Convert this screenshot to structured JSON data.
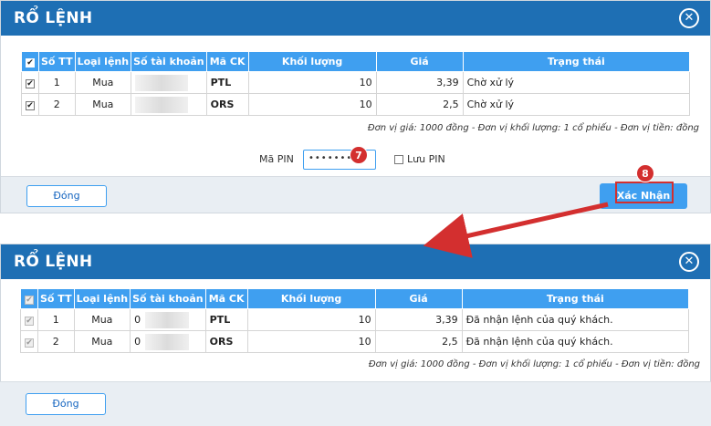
{
  "panels": {
    "before": {
      "title": "RỔ LỆNH",
      "close_icon": "close-circle-icon",
      "columns": [
        "Số TT",
        "Loại lệnh",
        "Số tài khoản",
        "Mã CK",
        "Khối lượng",
        "Giá",
        "Trạng thái"
      ],
      "rows": [
        {
          "check": "✔",
          "stt": "1",
          "type": "Mua",
          "account": "",
          "symbol": "PTL",
          "qty": "10",
          "price": "3,39",
          "status": "Chờ xử lý"
        },
        {
          "check": "✔",
          "stt": "2",
          "type": "Mua",
          "account": "",
          "symbol": "ORS",
          "qty": "10",
          "price": "2,5",
          "status": "Chờ xử lý"
        }
      ],
      "header_check": "✔",
      "unit_note": "Đơn vị giá: 1000 đồng - Đơn vị khối lượng: 1 cổ phiếu - Đơn vị tiền: đồng",
      "pin": {
        "label": "Mã PIN",
        "value": "••••••••",
        "save_label": "Lưu PIN"
      },
      "close_button": "Đóng",
      "confirm_button": "Xác Nhận",
      "step_7": "7",
      "step_8": "8"
    },
    "after": {
      "title": "RỔ LỆNH",
      "close_icon": "close-circle-icon",
      "columns": [
        "Số TT",
        "Loại lệnh",
        "Số tài khoản",
        "Mã CK",
        "Khối lượng",
        "Giá",
        "Trạng thái"
      ],
      "rows": [
        {
          "check": "✔",
          "stt": "1",
          "type": "Mua",
          "account": "0",
          "symbol": "PTL",
          "qty": "10",
          "price": "3,39",
          "status": "Đã nhận lệnh của quý khách."
        },
        {
          "check": "✔",
          "stt": "2",
          "type": "Mua",
          "account": "0",
          "symbol": "ORS",
          "qty": "10",
          "price": "2,5",
          "status": "Đã nhận lệnh của quý khách."
        }
      ],
      "header_check": "✔",
      "unit_note": "Đơn vị giá: 1000 đồng - Đơn vị khối lượng: 1 cổ phiếu - Đơn vị tiền: đồng",
      "close_button": "Đóng"
    }
  },
  "colors": {
    "header_blue": "#1e6fb4",
    "table_header": "#3f9ff0",
    "buy_green": "#22b14c",
    "annotation_red": "#d32f2f"
  }
}
